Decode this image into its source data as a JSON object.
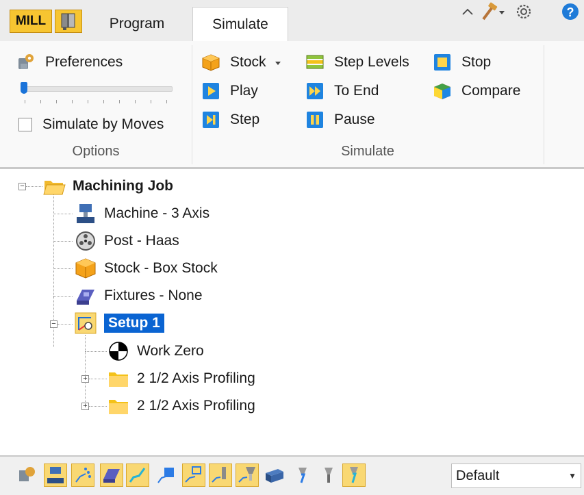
{
  "tabstrip": {
    "mill_label": "MILL",
    "tabs": [
      {
        "label": "Program",
        "active": false
      },
      {
        "label": "Simulate",
        "active": true
      }
    ],
    "right_icons": [
      "collapse-ribbon-icon",
      "hammer-icon",
      "dropdown-arrow-icon",
      "settings-gear-icon",
      "help-icon"
    ]
  },
  "ribbon": {
    "options_group": {
      "preferences_label": "Preferences",
      "simulate_by_moves_label": "Simulate by Moves",
      "simulate_by_moves_checked": false,
      "speed_level": 0,
      "label": "Options"
    },
    "simulate_group": {
      "stock_label": "Stock",
      "play_label": "Play",
      "step_label": "Step",
      "step_levels_label": "Step Levels",
      "to_end_label": "To End",
      "pause_label": "Pause",
      "stop_label": "Stop",
      "compare_label": "Compare",
      "label": "Simulate"
    }
  },
  "tree": {
    "root": {
      "label": "Machining Job",
      "expanded": true
    },
    "items": [
      {
        "label": "Machine - 3 Axis"
      },
      {
        "label": "Post - Haas"
      },
      {
        "label": "Stock - Box Stock"
      },
      {
        "label": "Fixtures - None"
      }
    ],
    "setup": {
      "label": "Setup 1",
      "selected": true,
      "expanded": true
    },
    "setup_children": [
      {
        "label": "Work Zero"
      },
      {
        "label": "2 1/2 Axis Profiling"
      },
      {
        "label": "2 1/2 Axis Profiling"
      }
    ]
  },
  "bottom_toolbar": {
    "icons": [
      {
        "name": "show-job-icon",
        "on": false
      },
      {
        "name": "show-machine-icon",
        "on": true
      },
      {
        "name": "show-toolpath-points-icon",
        "on": true
      },
      {
        "name": "show-fixture-icon",
        "on": true
      },
      {
        "name": "show-toolpath-icon",
        "on": true
      },
      {
        "name": "show-part-icon",
        "on": false
      },
      {
        "name": "show-feature-icon",
        "on": true
      },
      {
        "name": "show-tool-icon",
        "on": true
      },
      {
        "name": "show-holder-icon",
        "on": true
      },
      {
        "name": "show-stock-icon",
        "on": false
      },
      {
        "name": "tool-display-1-icon",
        "on": false
      },
      {
        "name": "tool-display-2-icon",
        "on": false
      },
      {
        "name": "tool-display-3-icon",
        "on": true
      }
    ],
    "view_select_value": "Default"
  },
  "colors": {
    "accent_yellow": "#f7c531",
    "selection_blue": "#0a64d2",
    "play_blue": "#1f84e0"
  }
}
